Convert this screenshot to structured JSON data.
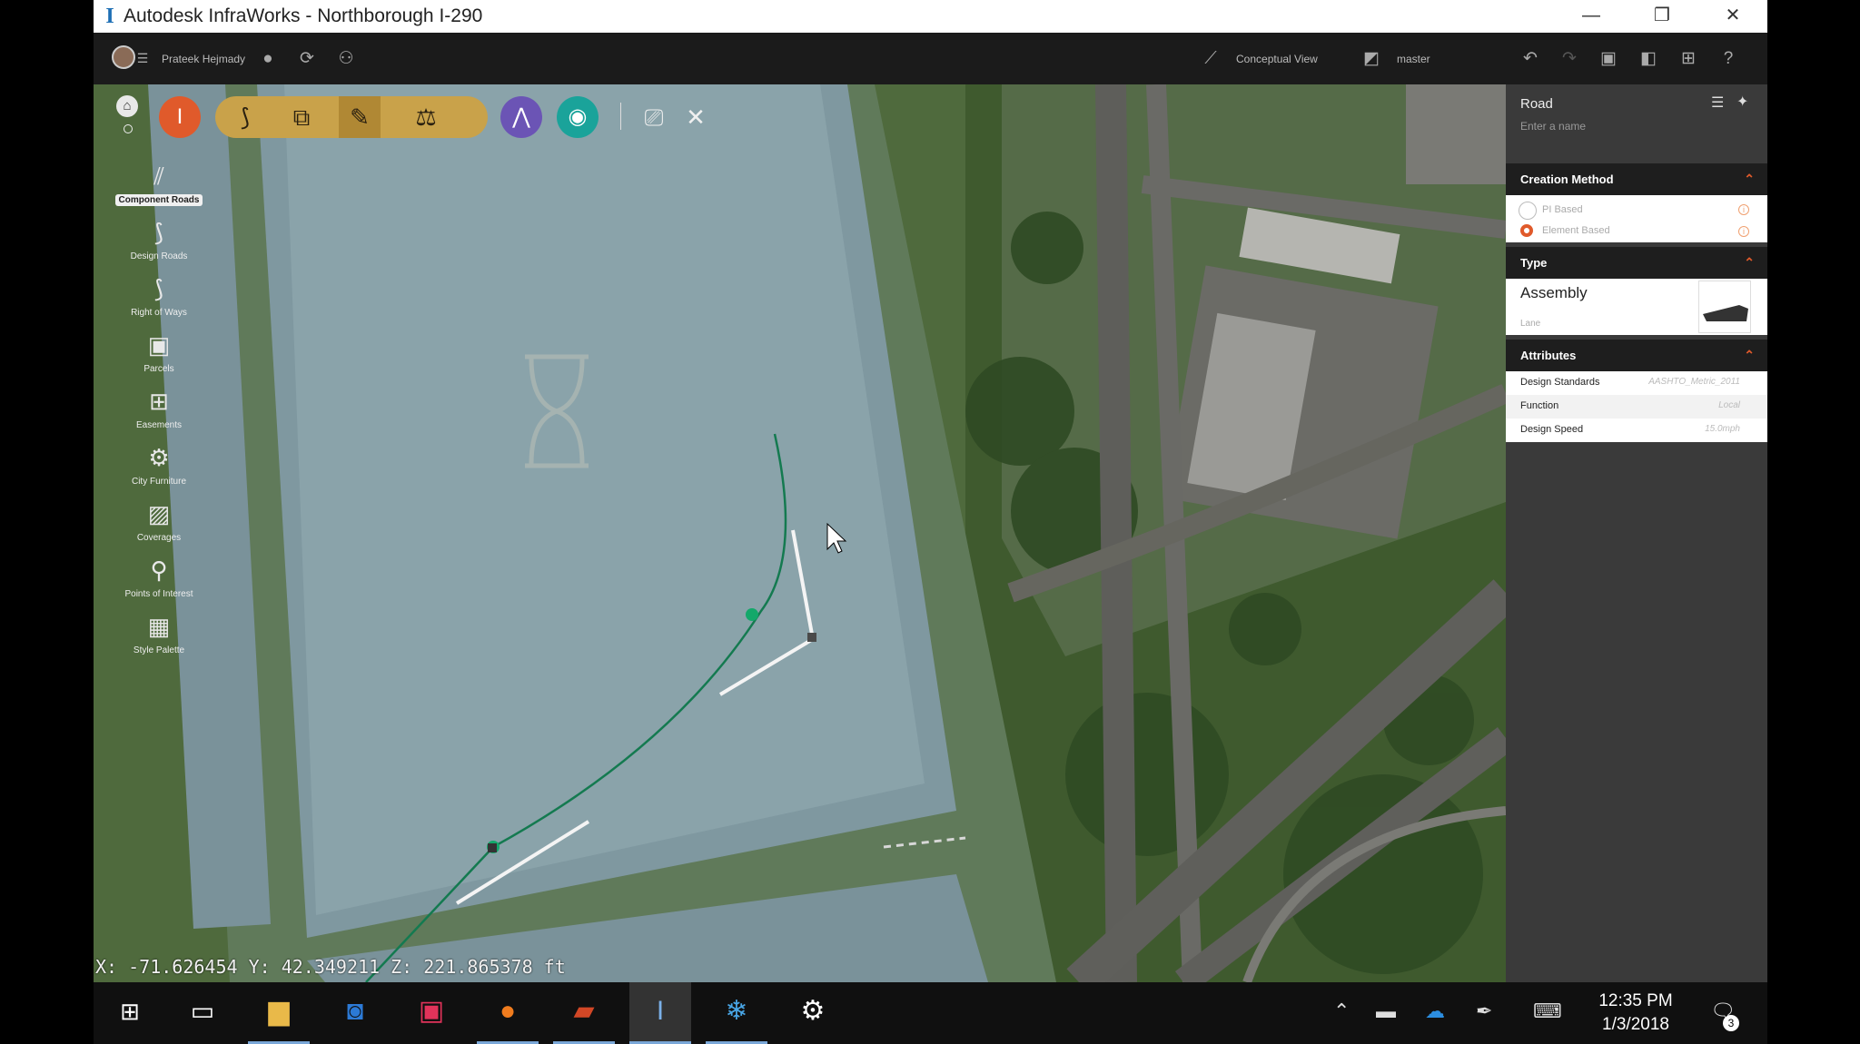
{
  "window": {
    "title": "Autodesk InfraWorks - Northborough I-290",
    "app_icon": "infraworks-logo",
    "controls": {
      "minimize": "—",
      "restore": "❐",
      "close": "✕"
    }
  },
  "appbar": {
    "user_name": "Prateek Hejmady",
    "view_mode": "Conceptual View",
    "branch": "master"
  },
  "toolbar": {
    "home_label": "⌂",
    "main_icon": "I"
  },
  "left_tools": [
    {
      "label": "Component Roads",
      "icon": "component-roads-icon",
      "glyph": "⫽"
    },
    {
      "label": "Design Roads",
      "icon": "design-roads-icon",
      "glyph": "⟆"
    },
    {
      "label": "Right of Ways",
      "icon": "right-of-ways-icon",
      "glyph": "⟆"
    },
    {
      "label": "Parcels",
      "icon": "parcels-icon",
      "glyph": "▣"
    },
    {
      "label": "Easements",
      "icon": "easements-icon",
      "glyph": "⊞"
    },
    {
      "label": "City Furniture",
      "icon": "city-furniture-icon",
      "glyph": "⚙"
    },
    {
      "label": "Coverages",
      "icon": "coverages-icon",
      "glyph": "▨"
    },
    {
      "label": "Points of Interest",
      "icon": "points-of-interest-icon",
      "glyph": "⚲"
    },
    {
      "label": "Style Palette",
      "icon": "style-palette-icon",
      "glyph": "▦"
    }
  ],
  "coordinates": "X: -71.626454 Y: 42.349211 Z: 221.865378 ft",
  "panel": {
    "title": "Road",
    "name_placeholder": "Enter a name",
    "creation_method": {
      "header": "Creation Method",
      "options": [
        {
          "label": "PI Based",
          "selected": false
        },
        {
          "label": "Element Based",
          "selected": true
        }
      ]
    },
    "type": {
      "header": "Type",
      "value": "Assembly",
      "sub": "Lane"
    },
    "attributes": {
      "header": "Attributes",
      "rows": [
        {
          "key": "Design Standards",
          "value": "AASHTO_Metric_2011"
        },
        {
          "key": "Function",
          "value": "Local"
        },
        {
          "key": "Design Speed",
          "value": "15.0mph"
        }
      ]
    }
  },
  "taskbar": {
    "time": "12:35 PM",
    "date": "1/3/2018",
    "notification_count": "3"
  },
  "colors": {
    "accent_orange": "#e05a2b",
    "toolbar_gold": "#c9a24a",
    "purple": "#6b54b5",
    "teal": "#1aa39a",
    "road_green": "#1a8a5a"
  }
}
